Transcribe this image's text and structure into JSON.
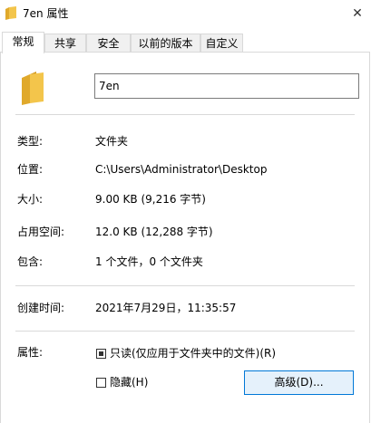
{
  "window": {
    "title": "7en 属性",
    "close_glyph": "✕"
  },
  "tabs": [
    {
      "label": "常规",
      "active": true
    },
    {
      "label": "共享",
      "active": false
    },
    {
      "label": "安全",
      "active": false
    },
    {
      "label": "以前的版本",
      "active": false
    },
    {
      "label": "自定义",
      "active": false
    }
  ],
  "general": {
    "name_value": "7en",
    "fields": [
      {
        "label": "类型:",
        "value": "文件夹"
      },
      {
        "label": "位置:",
        "value": "C:\\Users\\Administrator\\Desktop"
      },
      {
        "label": "大小:",
        "value": "9.00 KB (9,216 字节)"
      },
      {
        "label": "占用空间:",
        "value": "12.0 KB (12,288 字节)"
      },
      {
        "label": "包含:",
        "value": "1 个文件，0 个文件夹"
      },
      {
        "label": "创建时间:",
        "value": "2021年7月29日，11:35:57"
      }
    ],
    "attributes_label": "属性:",
    "readonly_label": "只读(仅应用于文件夹中的文件)(R)",
    "readonly_state": "mixed",
    "hidden_label": "隐藏(H)",
    "hidden_state": "unchecked",
    "advanced_button": "高级(D)..."
  },
  "icons": {
    "title_icon": "folder-icon",
    "big_icon": "folder-icon"
  },
  "colors": {
    "folder": "#f3c54b",
    "folder_dark": "#e0a92b",
    "button_border": "#0078d7",
    "button_bg": "#e5f1fb"
  }
}
